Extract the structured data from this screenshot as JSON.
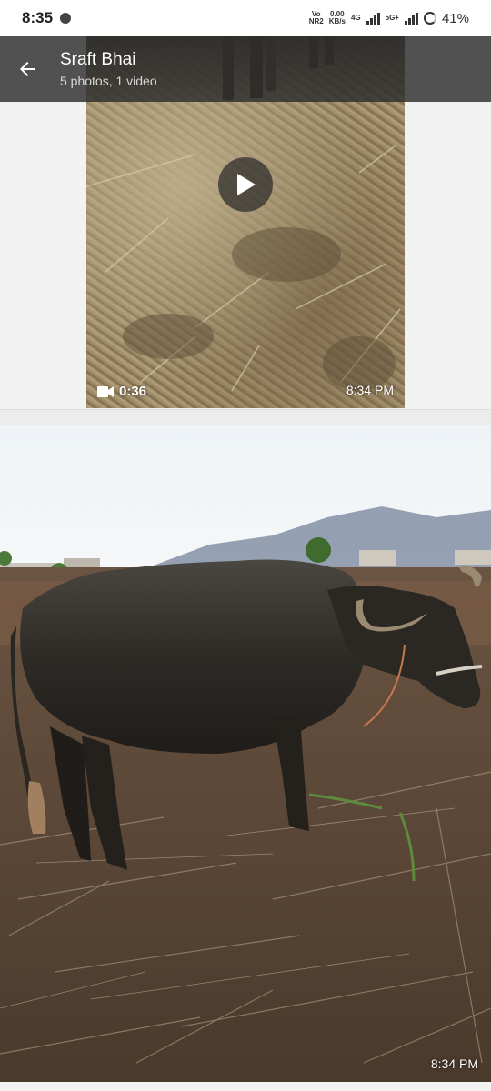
{
  "status_bar": {
    "time": "8:35",
    "net_vo": "Vo",
    "net_nr": "NR2",
    "speed": "0.00",
    "speed_unit": "KB/s",
    "net_4g": "4G",
    "net_5g": "5G+",
    "battery": "41%"
  },
  "header": {
    "title": "Sraft Bhai",
    "subtitle": "5 photos, 1 video"
  },
  "video": {
    "duration": "0:36",
    "time": "8:34 PM"
  },
  "photo": {
    "time": "8:34 PM"
  },
  "colors": {
    "header_bg": "#2d2d2d",
    "page_bg": "#f2f2f2"
  }
}
